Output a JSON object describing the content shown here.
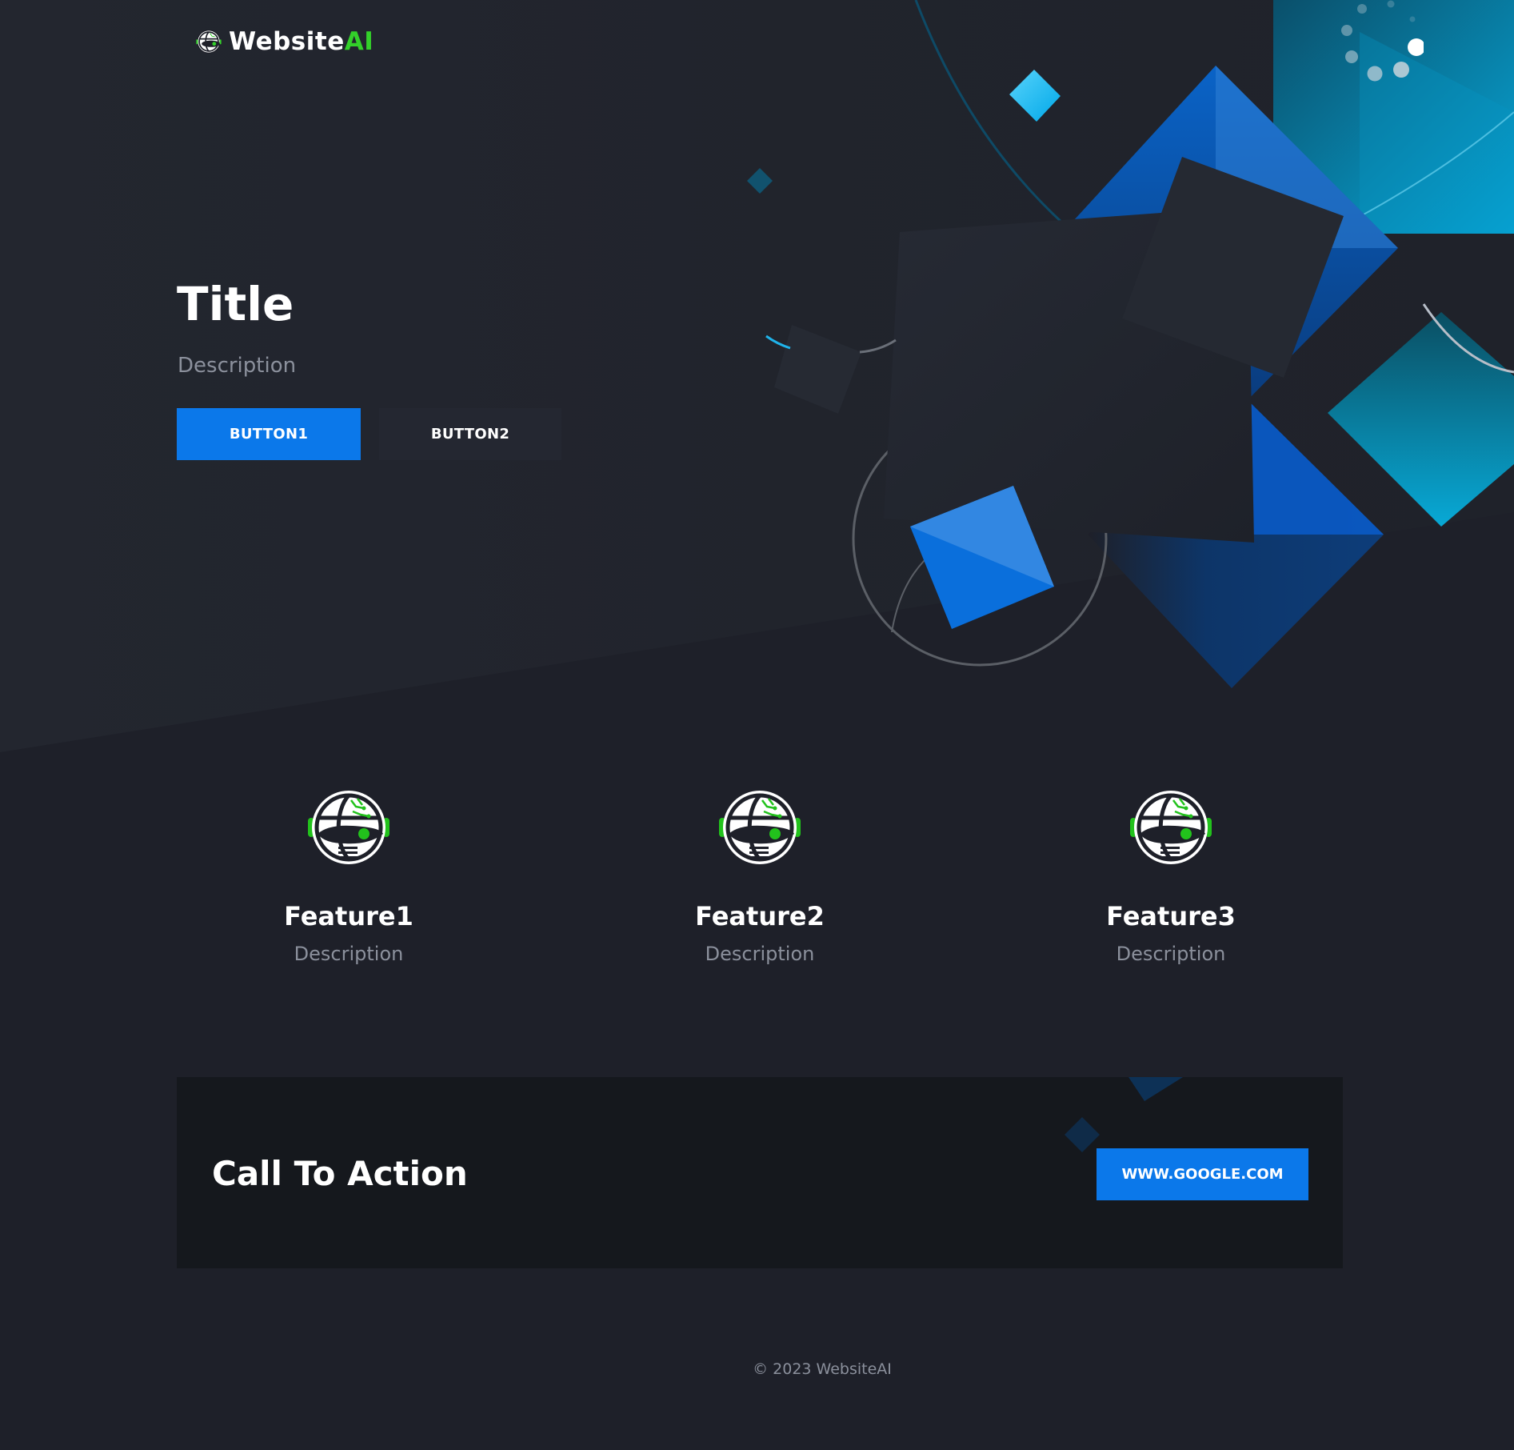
{
  "brand": {
    "name_main": "Website",
    "name_accent": "AI",
    "accent_color": "#33d02a",
    "icon": "globe-robot-icon"
  },
  "hero": {
    "title": "Title",
    "description": "Description",
    "button1_label": "BUTTON1",
    "button2_label": "BUTTON2"
  },
  "features": [
    {
      "icon": "globe-robot-icon",
      "title": "Feature1",
      "description": "Description"
    },
    {
      "icon": "globe-robot-icon",
      "title": "Feature2",
      "description": "Description"
    },
    {
      "icon": "globe-robot-icon",
      "title": "Feature3",
      "description": "Description"
    }
  ],
  "cta": {
    "title": "Call To Action",
    "button_label": "WWW.GOOGLE.COM"
  },
  "footer": {
    "copyright": "© 2023 WebsiteAI"
  },
  "colors": {
    "background": "#1e2029",
    "primary": "#0b78ea",
    "muted_text": "#8b909c",
    "cta_background": "#15181d"
  }
}
